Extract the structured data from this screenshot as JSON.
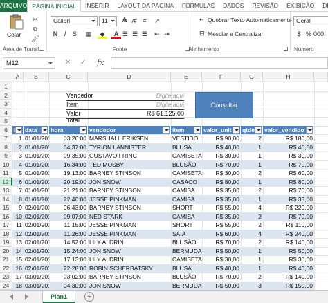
{
  "ribbon": {
    "tabs": [
      "ARQUIVO",
      "PÁGINA INICIAL",
      "INSERIR",
      "LAYOUT DA PÁGINA",
      "FÓRMULAS",
      "DADOS",
      "REVISÃO",
      "EXIBIÇÃO",
      "DESE"
    ],
    "active_tab": "PÁGINA INICIAL",
    "paste_label": "Colar",
    "groups": {
      "clipboard": "Área de Transf...",
      "font": "Fonte",
      "alignment": "Alinhamento",
      "number": "Número"
    },
    "font_name": "Calibri",
    "font_size": "11",
    "bold": "N",
    "italic": "I",
    "underline": "S",
    "grow_font": "A",
    "shrink_font": "A",
    "wrap_text": "Quebrar Texto Automaticamente",
    "merge_center": "Mesclar e Centralizar",
    "number_format": "Geral"
  },
  "formula_bar": {
    "name_box": "M12",
    "cancel": "✕",
    "confirm": "✓",
    "fx": "fx",
    "content": ""
  },
  "columns": [
    "A",
    "B",
    "C",
    "D",
    "E",
    "F",
    "G",
    "H"
  ],
  "rows": [
    "1",
    "2",
    "3",
    "4",
    "5",
    "6",
    "7",
    "8",
    "9",
    "10",
    "11",
    "12",
    "13",
    "14",
    "15",
    "16",
    "17",
    "18",
    "19",
    "20",
    "21",
    "22",
    "23",
    "24"
  ],
  "selected_row": "12",
  "filter": {
    "vendedor_label": "Vendedor",
    "vendedor_hint": "Digite aqui",
    "item_label": "Item",
    "item_hint": "Digite aqui",
    "total_label": "Valor Total",
    "total_value": "R$ 61.125,00",
    "consultar_label": "Consultar"
  },
  "table": {
    "headers": [
      "id",
      "data",
      "hora",
      "vendedor",
      "item",
      "valor_unit",
      "qtde",
      "valor_vendido"
    ],
    "rows": [
      [
        "1",
        "01/01/2018",
        "03:26:00",
        "MARSHALL ERIKSEN",
        "VESTIDO",
        "R$ 90,00",
        "2",
        "R$ 180,00"
      ],
      [
        "2",
        "01/01/2018",
        "04:37:00",
        "TYRION LANNISTER",
        "BLUSA",
        "R$ 40,00",
        "1",
        "R$ 40,00"
      ],
      [
        "3",
        "01/01/2018",
        "09:35:00",
        "GUSTAVO FRING",
        "CAMISETA",
        "R$ 30,00",
        "1",
        "R$ 30,00"
      ],
      [
        "4",
        "01/01/2018",
        "16:34:00",
        "TED MOSBY",
        "BLUSÃO",
        "R$ 70,00",
        "1",
        "R$ 70,00"
      ],
      [
        "5",
        "01/01/2018",
        "19:13:00",
        "BARNEY STINSON",
        "CAMISETA",
        "R$ 30,00",
        "2",
        "R$ 60,00"
      ],
      [
        "6",
        "01/01/2018",
        "20:19:00",
        "JON SNOW",
        "CASACO",
        "R$ 80,00",
        "1",
        "R$ 80,00"
      ],
      [
        "7",
        "01/01/2018",
        "21:21:00",
        "BARNEY STINSON",
        "CAMISA",
        "R$ 35,00",
        "2",
        "R$ 70,00"
      ],
      [
        "8",
        "01/01/2018",
        "22:40:00",
        "JESSE PINKMAN",
        "CAMISA",
        "R$ 35,00",
        "1",
        "R$ 35,00"
      ],
      [
        "9",
        "02/01/2018",
        "06:43:00",
        "BARNEY STINSON",
        "SHORT",
        "R$ 55,00",
        "4",
        "R$ 220,00"
      ],
      [
        "10",
        "02/01/2018",
        "09:07:00",
        "NED STARK",
        "CAMISA",
        "R$ 35,00",
        "2",
        "R$ 70,00"
      ],
      [
        "11",
        "02/01/2018",
        "11:15:00",
        "JESSE PINKMAN",
        "SHORT",
        "R$ 55,00",
        "2",
        "R$ 110,00"
      ],
      [
        "12",
        "02/01/2018",
        "11:26:00",
        "JESSE PINKMAN",
        "SAIA",
        "R$ 60,00",
        "4",
        "R$ 240,00"
      ],
      [
        "13",
        "02/01/2018",
        "14:52:00",
        "LILY ALDRIN",
        "BLUSÃO",
        "R$ 70,00",
        "2",
        "R$ 140,00"
      ],
      [
        "14",
        "02/01/2018",
        "15:24:00",
        "JON SNOW",
        "BERMUDA",
        "R$ 50,00",
        "1",
        "R$ 50,00"
      ],
      [
        "15",
        "02/01/2018",
        "17:13:00",
        "LILY ALDRIN",
        "CAMISETA",
        "R$ 30,00",
        "1",
        "R$ 30,00"
      ],
      [
        "16",
        "02/01/2018",
        "22:28:00",
        "ROBIN SCHERBATSKY",
        "BLUSA",
        "R$ 40,00",
        "1",
        "R$ 40,00"
      ],
      [
        "17",
        "03/01/2018",
        "03:02:00",
        "BARNEY STINSON",
        "BLUSÃO",
        "R$ 70,00",
        "2",
        "R$ 140,00"
      ],
      [
        "18",
        "03/01/2018",
        "04:30:00",
        "JON SNOW",
        "BERMUDA",
        "R$ 50,00",
        "3",
        "R$ 150,00"
      ]
    ]
  },
  "sheets": [
    "Plan1"
  ],
  "add_sheet": "+",
  "colors": {
    "accent": "#217346",
    "table_header": "#4f81bd",
    "band": "#dce6f1"
  }
}
